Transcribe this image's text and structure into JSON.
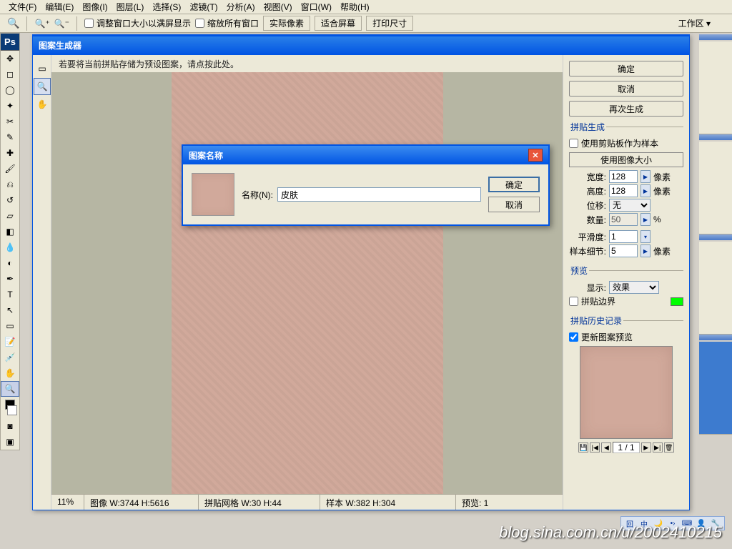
{
  "menu": {
    "file": "文件(F)",
    "edit": "编辑(E)",
    "image": "图像(I)",
    "layer": "图层(L)",
    "select": "选择(S)",
    "filter": "滤镜(T)",
    "analysis": "分析(A)",
    "view": "视图(V)",
    "window": "窗口(W)",
    "help": "帮助(H)"
  },
  "options": {
    "fit": "调整窗口大小以满屏显示",
    "zoom_all": "缩放所有窗口",
    "actual": "实际像素",
    "fit_screen": "适合屏幕",
    "print_size": "打印尺寸",
    "workspace": "工作区"
  },
  "toolbox": {
    "logo": "Ps"
  },
  "pm": {
    "title": "图案生成器",
    "hint": "若要将当前拼贴存储为预设图案，请点按此处。",
    "status": {
      "zoom": "11%",
      "img": "图像 W:3744 H:5616",
      "grid": "拼贴网格 W:30 H:44",
      "sample": "样本 W:382 H:304",
      "preview": "预览: 1"
    },
    "btn": {
      "ok": "确定",
      "cancel": "取消",
      "again": "再次生成"
    },
    "gen": {
      "legend": "拼贴生成",
      "use_clip": "使用剪贴板作为样本",
      "use_img": "使用图像大小",
      "width_l": "宽度:",
      "width_v": "128",
      "height_l": "高度:",
      "height_v": "128",
      "px": "像素",
      "offset_l": "位移:",
      "offset_v": "无",
      "amount_l": "数量:",
      "amount_v": "50",
      "pct": "%",
      "smooth_l": "平滑度:",
      "smooth_v": "1",
      "detail_l": "样本细节:",
      "detail_v": "5"
    },
    "prev": {
      "legend": "预览",
      "show_l": "显示:",
      "show_v": "效果",
      "bounds": "拼贴边界"
    },
    "hist": {
      "legend": "拼贴历史记录",
      "update": "更新图案预览",
      "count": "1 / 1"
    }
  },
  "modal": {
    "title": "图案名称",
    "name_l": "名称(N):",
    "name_v": "皮肤",
    "ok": "确定",
    "cancel": "取消"
  },
  "watermark": "blog.sina.com.cn/u/2002410215"
}
